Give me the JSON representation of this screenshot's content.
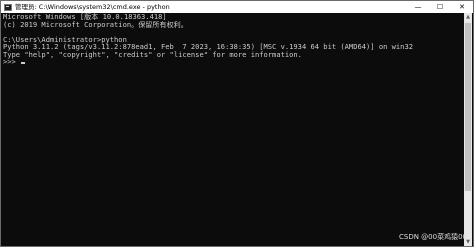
{
  "window": {
    "title": "管理员: C:\\Windows\\system32\\cmd.exe - python",
    "minimize_glyph": "—",
    "maximize_glyph": "☐",
    "close_glyph": "✕",
    "icon": "cmd-icon"
  },
  "console": {
    "lines": [
      "Microsoft Windows [版本 10.0.18363.418]",
      "(c) 2019 Microsoft Corporation。保留所有权利。",
      "",
      "C:\\Users\\Administrator>python",
      "Python 3.11.2 (tags/v3.11.2:878ead1, Feb  7 2023, 16:38:35) [MSC v.1934 64 bit (AMD64)] on win32",
      "Type \"help\", \"copyright\", \"credits\" or \"license\" for more information."
    ],
    "prompt": ">>> "
  },
  "scrollbar": {
    "up_glyph": "▲",
    "down_glyph": "▼"
  },
  "watermark": "CSDN @00菜鸡猿00",
  "colors": {
    "console_bg": "#0c0c0c",
    "console_text": "#cccccc",
    "titlebar_bg": "#ffffff"
  }
}
